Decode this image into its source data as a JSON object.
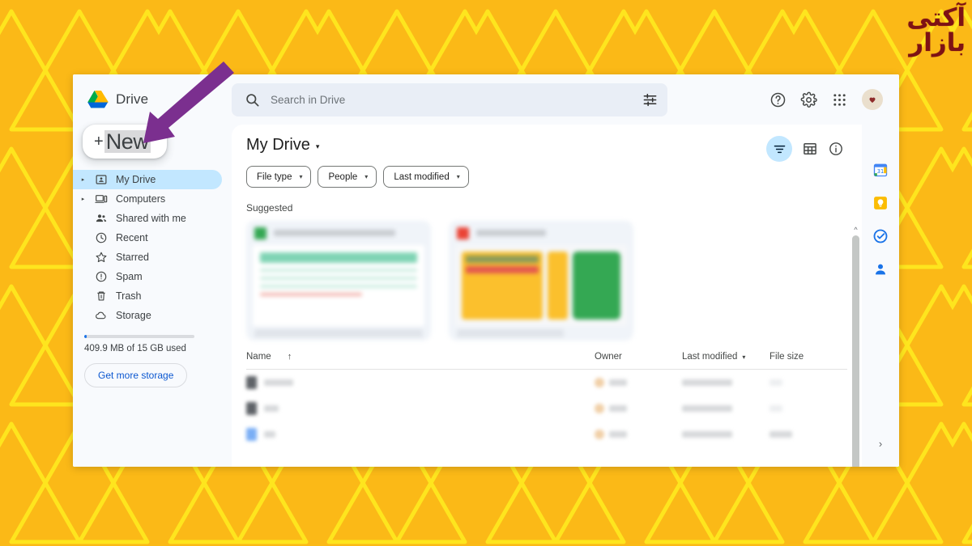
{
  "watermark": {
    "text": "آکتی بازار",
    "color": "#7e1214"
  },
  "background": {
    "base_color": "#FBB917",
    "pattern_color": "#FFE81F",
    "pattern": "triangles"
  },
  "annotation": {
    "arrow_color": "#7b2f8f",
    "points_to": "new-button"
  },
  "header": {
    "brand": "Drive",
    "logo_icon": "google-drive-logo",
    "search": {
      "placeholder": "Search in Drive",
      "value": "",
      "icon": "search-icon",
      "options_icon": "tune-icon"
    },
    "help_icon": "help-circle-icon",
    "settings_icon": "gear-icon",
    "apps_icon": "apps-grid-icon",
    "avatar_icon": "account-avatar"
  },
  "sidebar": {
    "new_button": {
      "plus": "+",
      "label": "New"
    },
    "items": [
      {
        "label": "My Drive",
        "icon": "my-drive-icon",
        "caret": true,
        "active": true
      },
      {
        "label": "Computers",
        "icon": "computers-icon",
        "caret": true,
        "active": false
      },
      {
        "label": "Shared with me",
        "icon": "shared-with-me-icon",
        "caret": false,
        "active": false
      },
      {
        "label": "Recent",
        "icon": "clock-icon",
        "caret": false,
        "active": false
      },
      {
        "label": "Starred",
        "icon": "star-icon",
        "caret": false,
        "active": false
      },
      {
        "label": "Spam",
        "icon": "spam-icon",
        "caret": false,
        "active": false
      },
      {
        "label": "Trash",
        "icon": "trash-icon",
        "caret": false,
        "active": false
      },
      {
        "label": "Storage",
        "icon": "cloud-icon",
        "caret": false,
        "active": false
      }
    ],
    "storage": {
      "text": "409.9 MB of 15 GB used",
      "used_percent": 2.7,
      "button_label": "Get more storage",
      "bar_fill_color": "#1a73e8"
    }
  },
  "main": {
    "title": "My Drive",
    "title_caret": "▾",
    "chips": [
      {
        "label": "File type"
      },
      {
        "label": "People"
      },
      {
        "label": "Last modified"
      }
    ],
    "view_tools": {
      "filter_icon": "filter-active-icon",
      "filter_active_color": "#c2e7ff",
      "grid_view_icon": "grid-view-icon",
      "details_icon": "info-icon"
    },
    "suggested_label": "Suggested",
    "suggested_cards": [
      {
        "file_type_color": "#34a853",
        "accent": "#9fdcc4",
        "title_blurred": true
      },
      {
        "file_type_color": "#ea4335",
        "accent": "#fbbc04",
        "title_blurred": true
      }
    ],
    "list_headers": {
      "name": "Name",
      "sort_arrow": "↑",
      "owner": "Owner",
      "last_modified": "Last modified",
      "modified_caret": "▾",
      "file_size": "File size"
    },
    "rows": [
      {
        "icon_color": "#5f6368",
        "name_blurred": true
      },
      {
        "icon_color": "#5f6368",
        "name_blurred": true
      },
      {
        "icon_color": "#4285f4",
        "name_blurred": true
      }
    ],
    "scrollbar": {
      "up_arrow": "^"
    }
  },
  "rail": {
    "items": [
      {
        "icon": "google-calendar-icon"
      },
      {
        "icon": "google-keep-icon"
      },
      {
        "icon": "google-tasks-icon"
      },
      {
        "icon": "google-contacts-icon"
      }
    ],
    "expand_chevron": "›"
  }
}
